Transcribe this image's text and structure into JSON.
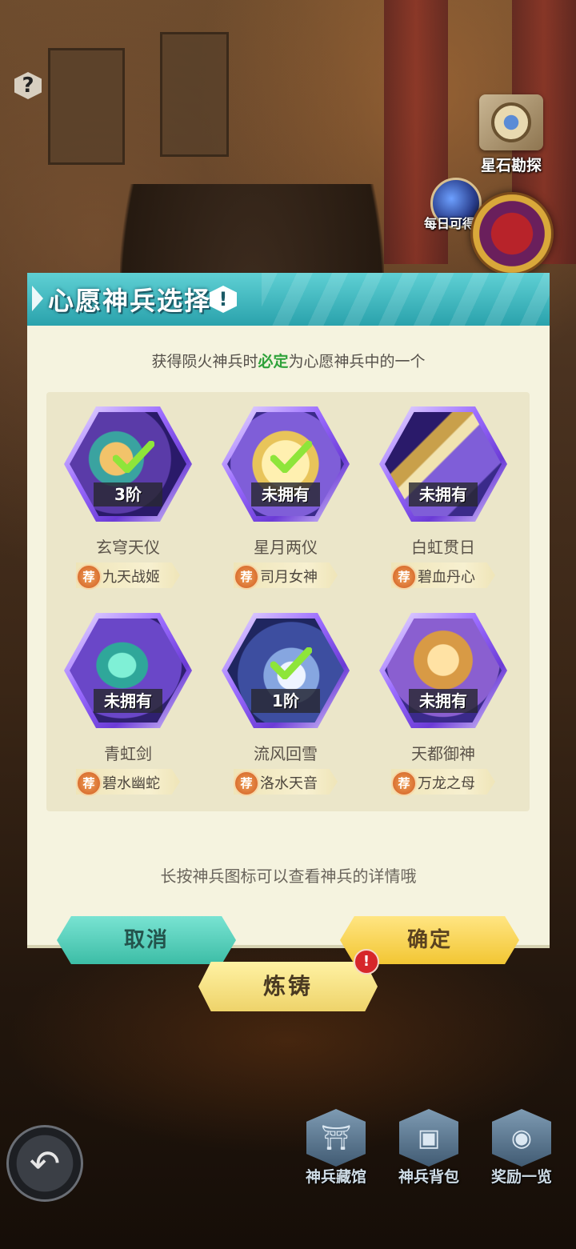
{
  "top": {
    "help_icon": "?"
  },
  "side": {
    "star_stone_label": "星石勘探",
    "daily_label": "每日可得"
  },
  "modal": {
    "title": "心愿神兵选择",
    "info_icon": "!",
    "subtitle_prefix": "获得陨火神兵时",
    "subtitle_highlight": "必定",
    "subtitle_suffix": "为心愿神兵中的一个",
    "rec_badge": "荐",
    "cards": [
      {
        "name": "玄穹天仪",
        "status": "3阶",
        "checked": true,
        "rec": "九天战姬"
      },
      {
        "name": "星月两仪",
        "status": "未拥有",
        "checked": true,
        "rec": "司月女神"
      },
      {
        "name": "白虹贯日",
        "status": "未拥有",
        "checked": false,
        "rec": "碧血丹心"
      },
      {
        "name": "青虹剑",
        "status": "未拥有",
        "checked": false,
        "rec": "碧水幽蛇"
      },
      {
        "name": "流风回雪",
        "status": "1阶",
        "checked": true,
        "rec": "洛水天音"
      },
      {
        "name": "天都御神",
        "status": "未拥有",
        "checked": false,
        "rec": "万龙之母"
      }
    ],
    "hint": "长按神兵图标可以查看神兵的详情哦",
    "cancel_label": "取消",
    "confirm_label": "确定"
  },
  "forge": {
    "label": "炼铸",
    "alert": "!"
  },
  "bottom_nav": [
    {
      "label": "神兵藏馆",
      "icon": "vault-icon"
    },
    {
      "label": "神兵背包",
      "icon": "backpack-icon"
    },
    {
      "label": "奖励一览",
      "icon": "reward-chest-icon"
    }
  ],
  "colors": {
    "accent_teal": "#2aa2ac",
    "highlight_green": "#2fa23a",
    "confirm_yellow": "#f2c633"
  }
}
